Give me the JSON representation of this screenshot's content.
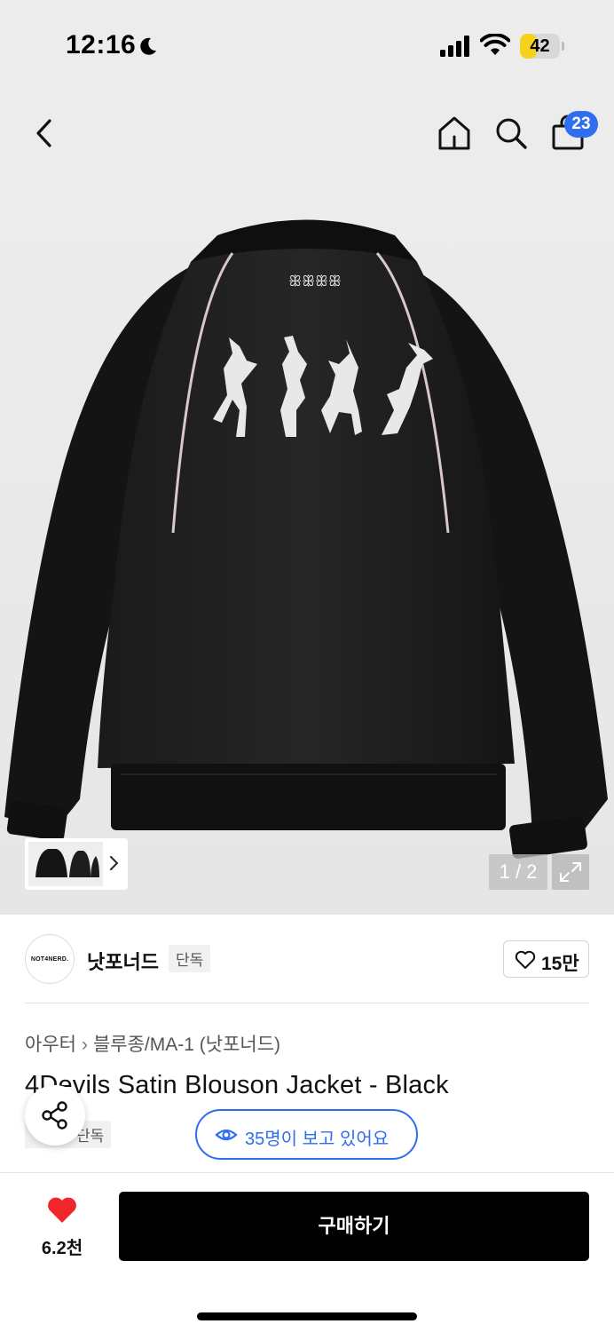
{
  "status_bar": {
    "time": "12:16",
    "battery_level": 42,
    "battery_label": "42",
    "icons": [
      "moon-icon",
      "signal-icon",
      "wifi-icon",
      "battery-icon"
    ]
  },
  "nav": {
    "icons": [
      "back-icon",
      "home-icon",
      "search-icon",
      "cart-icon"
    ],
    "cart_badge": "23",
    "accent_color": "#2f6ef0"
  },
  "gallery": {
    "pager": "1 / 2",
    "thumbnail_chevron_icon": "chevron-right-icon",
    "expand_icon": "expand-icon"
  },
  "brand": {
    "logo_text": "NOT4NERD.",
    "name": "낫포너드",
    "exclusive_tag": "단독",
    "like_count": "15만"
  },
  "product": {
    "breadcrumb": [
      "아우터",
      "블루종/MA-1 (낫포너드)"
    ],
    "title": "4Devils Satin Blouson Jacket - Black",
    "tag": "단독",
    "viewers": "35명이 보고 있어요"
  },
  "bottom_bar": {
    "wish_count": "6.2천",
    "buy_label": "구매하기",
    "heart_color": "#f0262b"
  }
}
